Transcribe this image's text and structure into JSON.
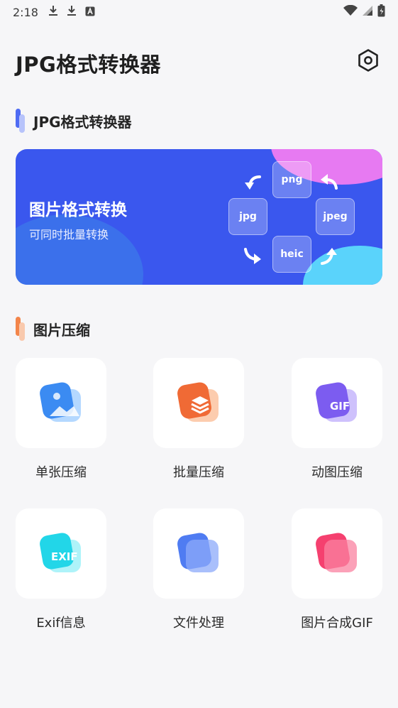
{
  "status_bar": {
    "time": "2:18",
    "left_icons": [
      "download-icon",
      "download-icon",
      "a-icon"
    ],
    "right_icons": [
      "wifi-icon",
      "signal-icon",
      "battery-icon"
    ]
  },
  "header": {
    "title": "JPG格式转换器",
    "settings_icon": "gear-icon"
  },
  "section_convert": {
    "title": "JPG格式转换器"
  },
  "banner": {
    "title": "图片格式转换",
    "subtitle": "可同时批量转换",
    "formats": [
      "png",
      "jpg",
      "jpeg",
      "heic"
    ],
    "colors": {
      "base": "#3a57ee",
      "pink": "#e77af2",
      "cyan": "#5ad3fb"
    }
  },
  "section_compress": {
    "title": "图片压缩"
  },
  "tiles": [
    {
      "label": "单张压缩",
      "icon": "single-image-icon",
      "icon_text": ""
    },
    {
      "label": "批量压缩",
      "icon": "layers-icon",
      "icon_text": ""
    },
    {
      "label": "动图压缩",
      "icon": "gif-icon",
      "icon_text": "GIF"
    },
    {
      "label": "Exif信息",
      "icon": "exif-icon",
      "icon_text": "EXIF"
    },
    {
      "label": "文件处理",
      "icon": "file-stack-icon",
      "icon_text": ""
    },
    {
      "label": "图片合成GIF",
      "icon": "gif-merge-icon",
      "icon_text": ""
    }
  ]
}
